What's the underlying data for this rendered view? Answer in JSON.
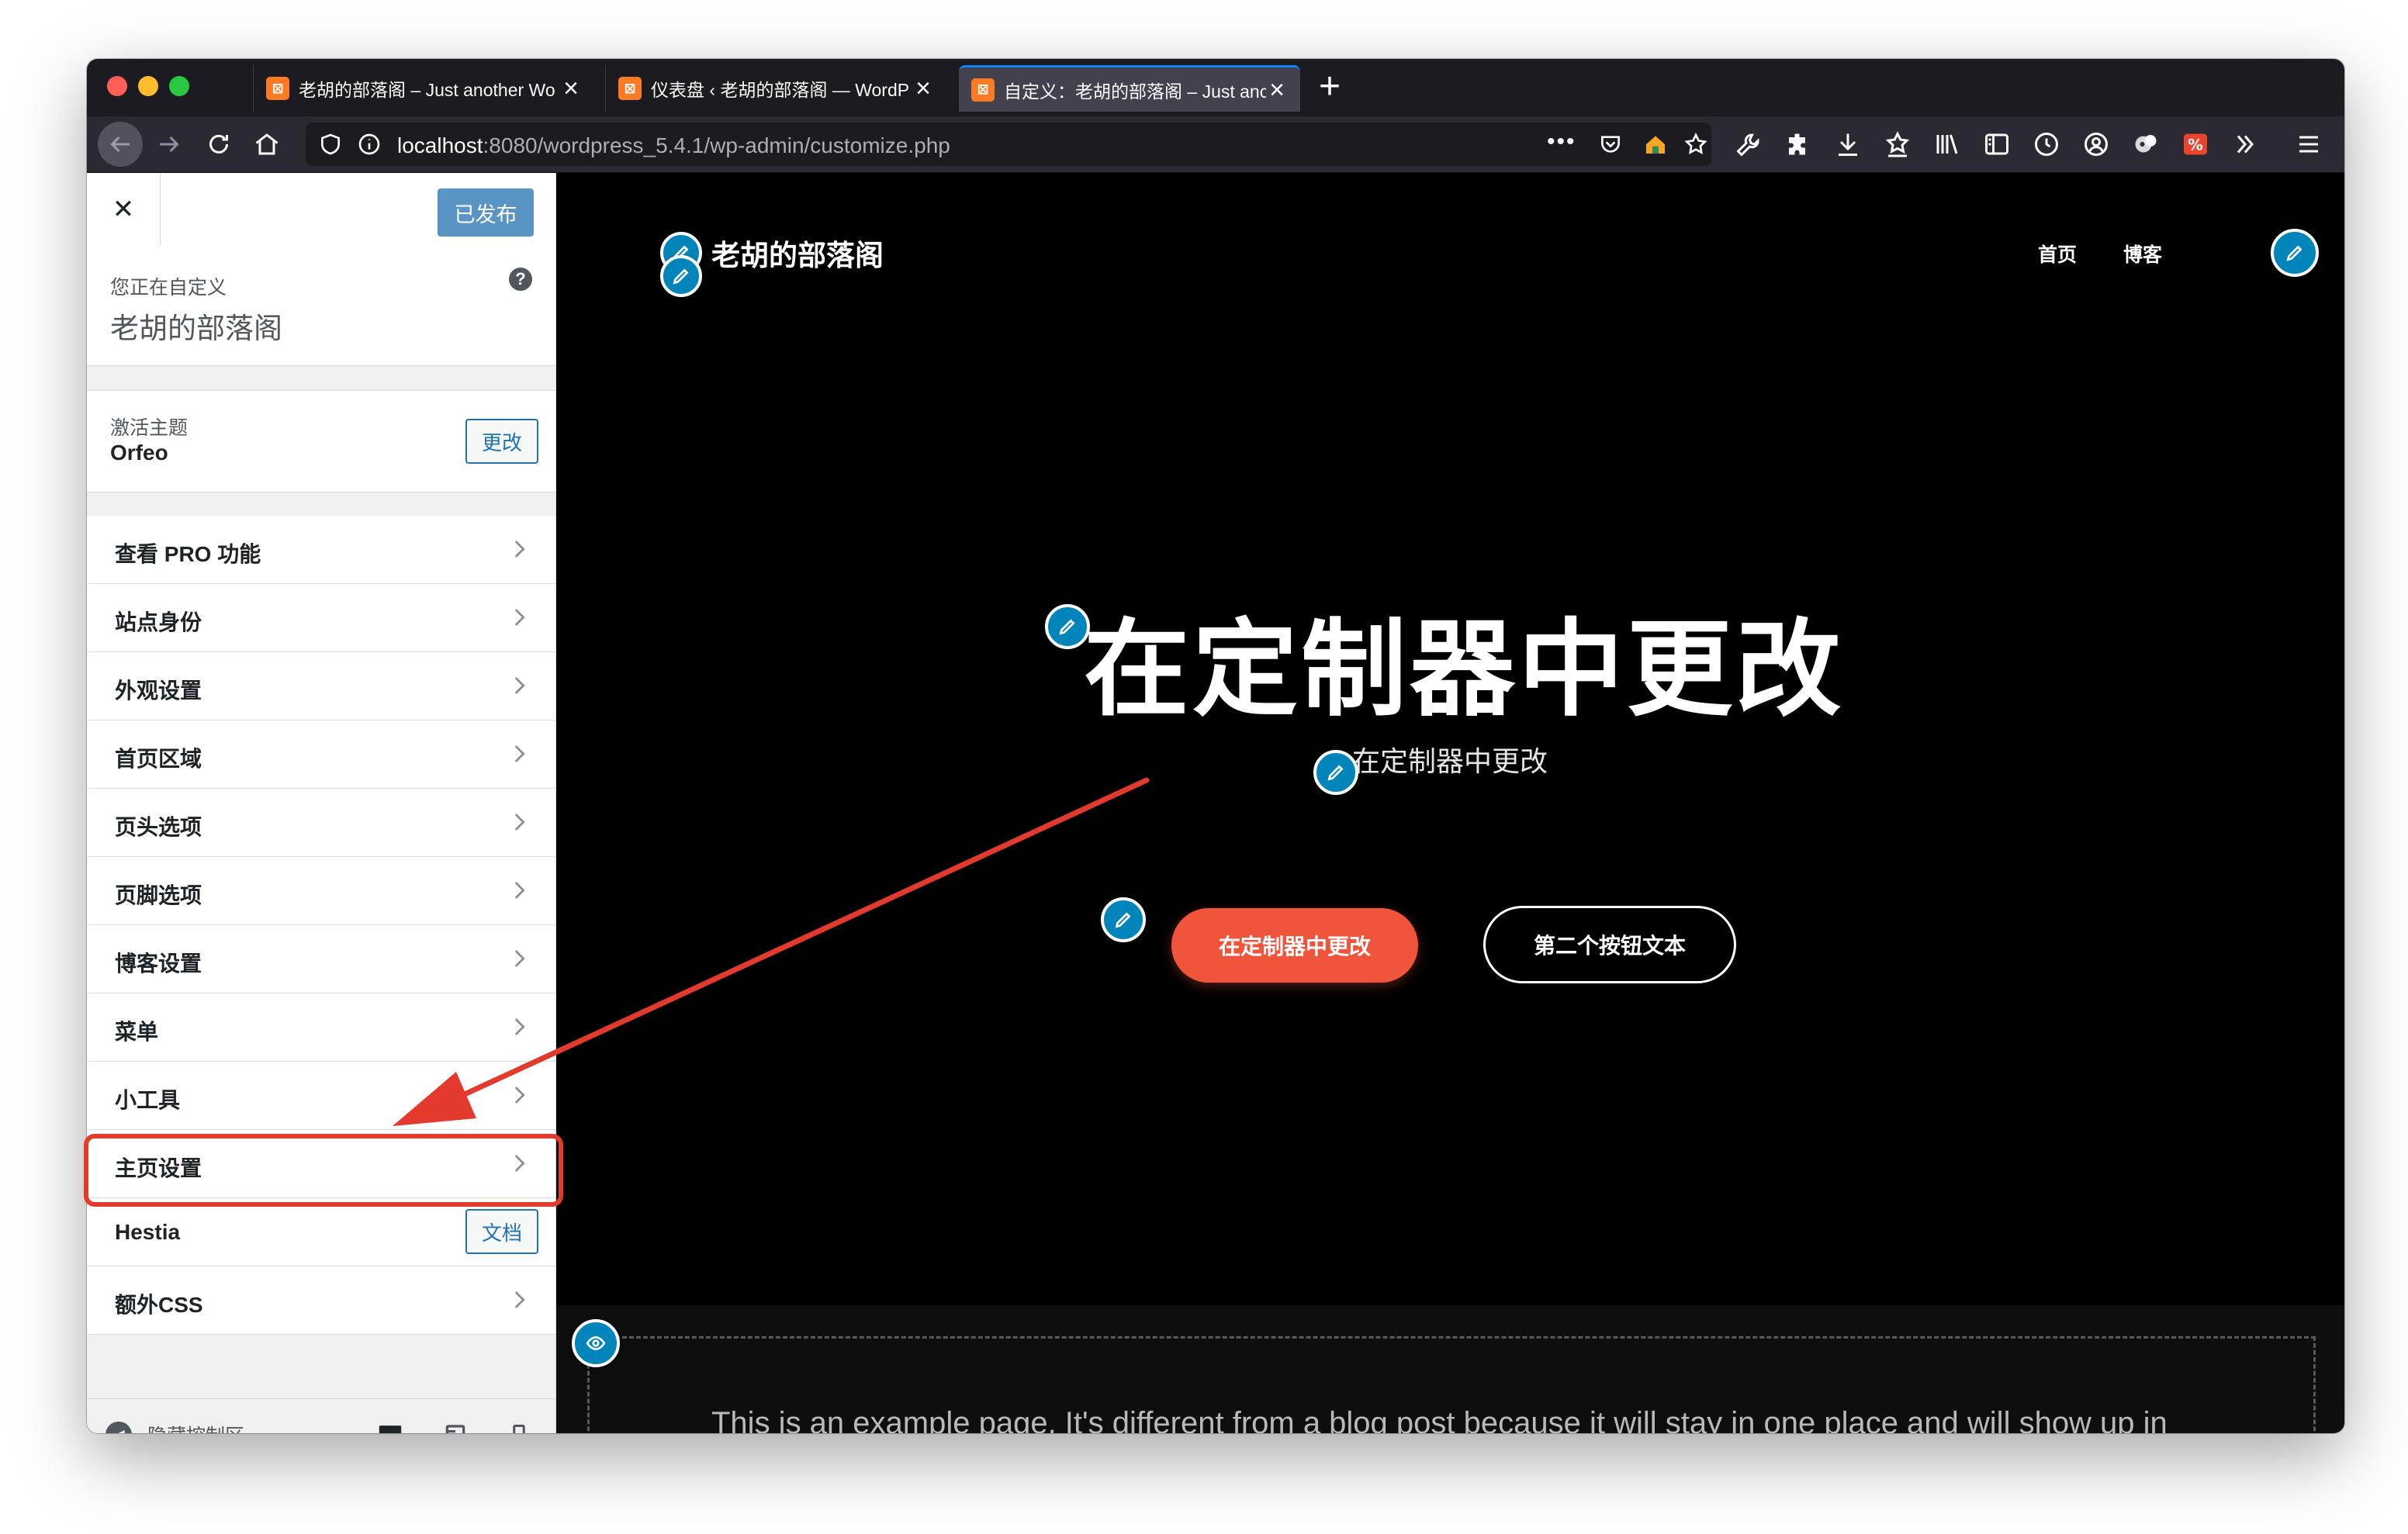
{
  "browser": {
    "tabs": [
      {
        "title": "老胡的部落阁 – Just another Wo",
        "active": false
      },
      {
        "title": "仪表盘 ‹ 老胡的部落阁 — WordP",
        "active": false
      },
      {
        "title": "自定义：老胡的部落阁 – Just anc",
        "active": true
      }
    ],
    "new_tab": "+",
    "url_host": "localhost",
    "url_rest": ":8080/wordpress_5.4.1/wp-admin/customize.php",
    "more": "•••",
    "accent_color": "#0a84ff"
  },
  "sidebar": {
    "close": "✕",
    "publish_label": "已发布",
    "customizing_label": "您正在自定义",
    "site_name": "老胡的部落阁",
    "help": "?",
    "active_theme_label": "激活主题",
    "theme_name": "Orfeo",
    "change_label": "更改",
    "items": [
      {
        "label": "查看 PRO 功能"
      },
      {
        "label": "站点身份"
      },
      {
        "label": "外观设置"
      },
      {
        "label": "首页区域"
      },
      {
        "label": "页头选项"
      },
      {
        "label": "页脚选项"
      },
      {
        "label": "博客设置"
      },
      {
        "label": "菜单"
      },
      {
        "label": "小工具"
      },
      {
        "label": "主页设置",
        "highlighted": true
      },
      {
        "label": "Hestia",
        "button": "文档"
      },
      {
        "label": "额外CSS"
      }
    ],
    "hide_controls": "隐藏控制区",
    "devices": [
      "desktop-icon",
      "tablet-icon",
      "mobile-icon"
    ],
    "active_device": "desktop"
  },
  "preview": {
    "site_title": "老胡的部落阁",
    "nav": [
      "首页",
      "博客"
    ],
    "hero_title": "在定制器中更改",
    "hero_subtitle": "在定制器中更改",
    "primary_button": "在定制器中更改",
    "secondary_button": "第二个按钮文本",
    "content_text": "This is an example page. It's different from a blog post because it will stay in one place and will show up in",
    "primary_color": "#f0553b",
    "edit_color": "#0085ba"
  },
  "annotation": {
    "color": "#e23b2e"
  }
}
